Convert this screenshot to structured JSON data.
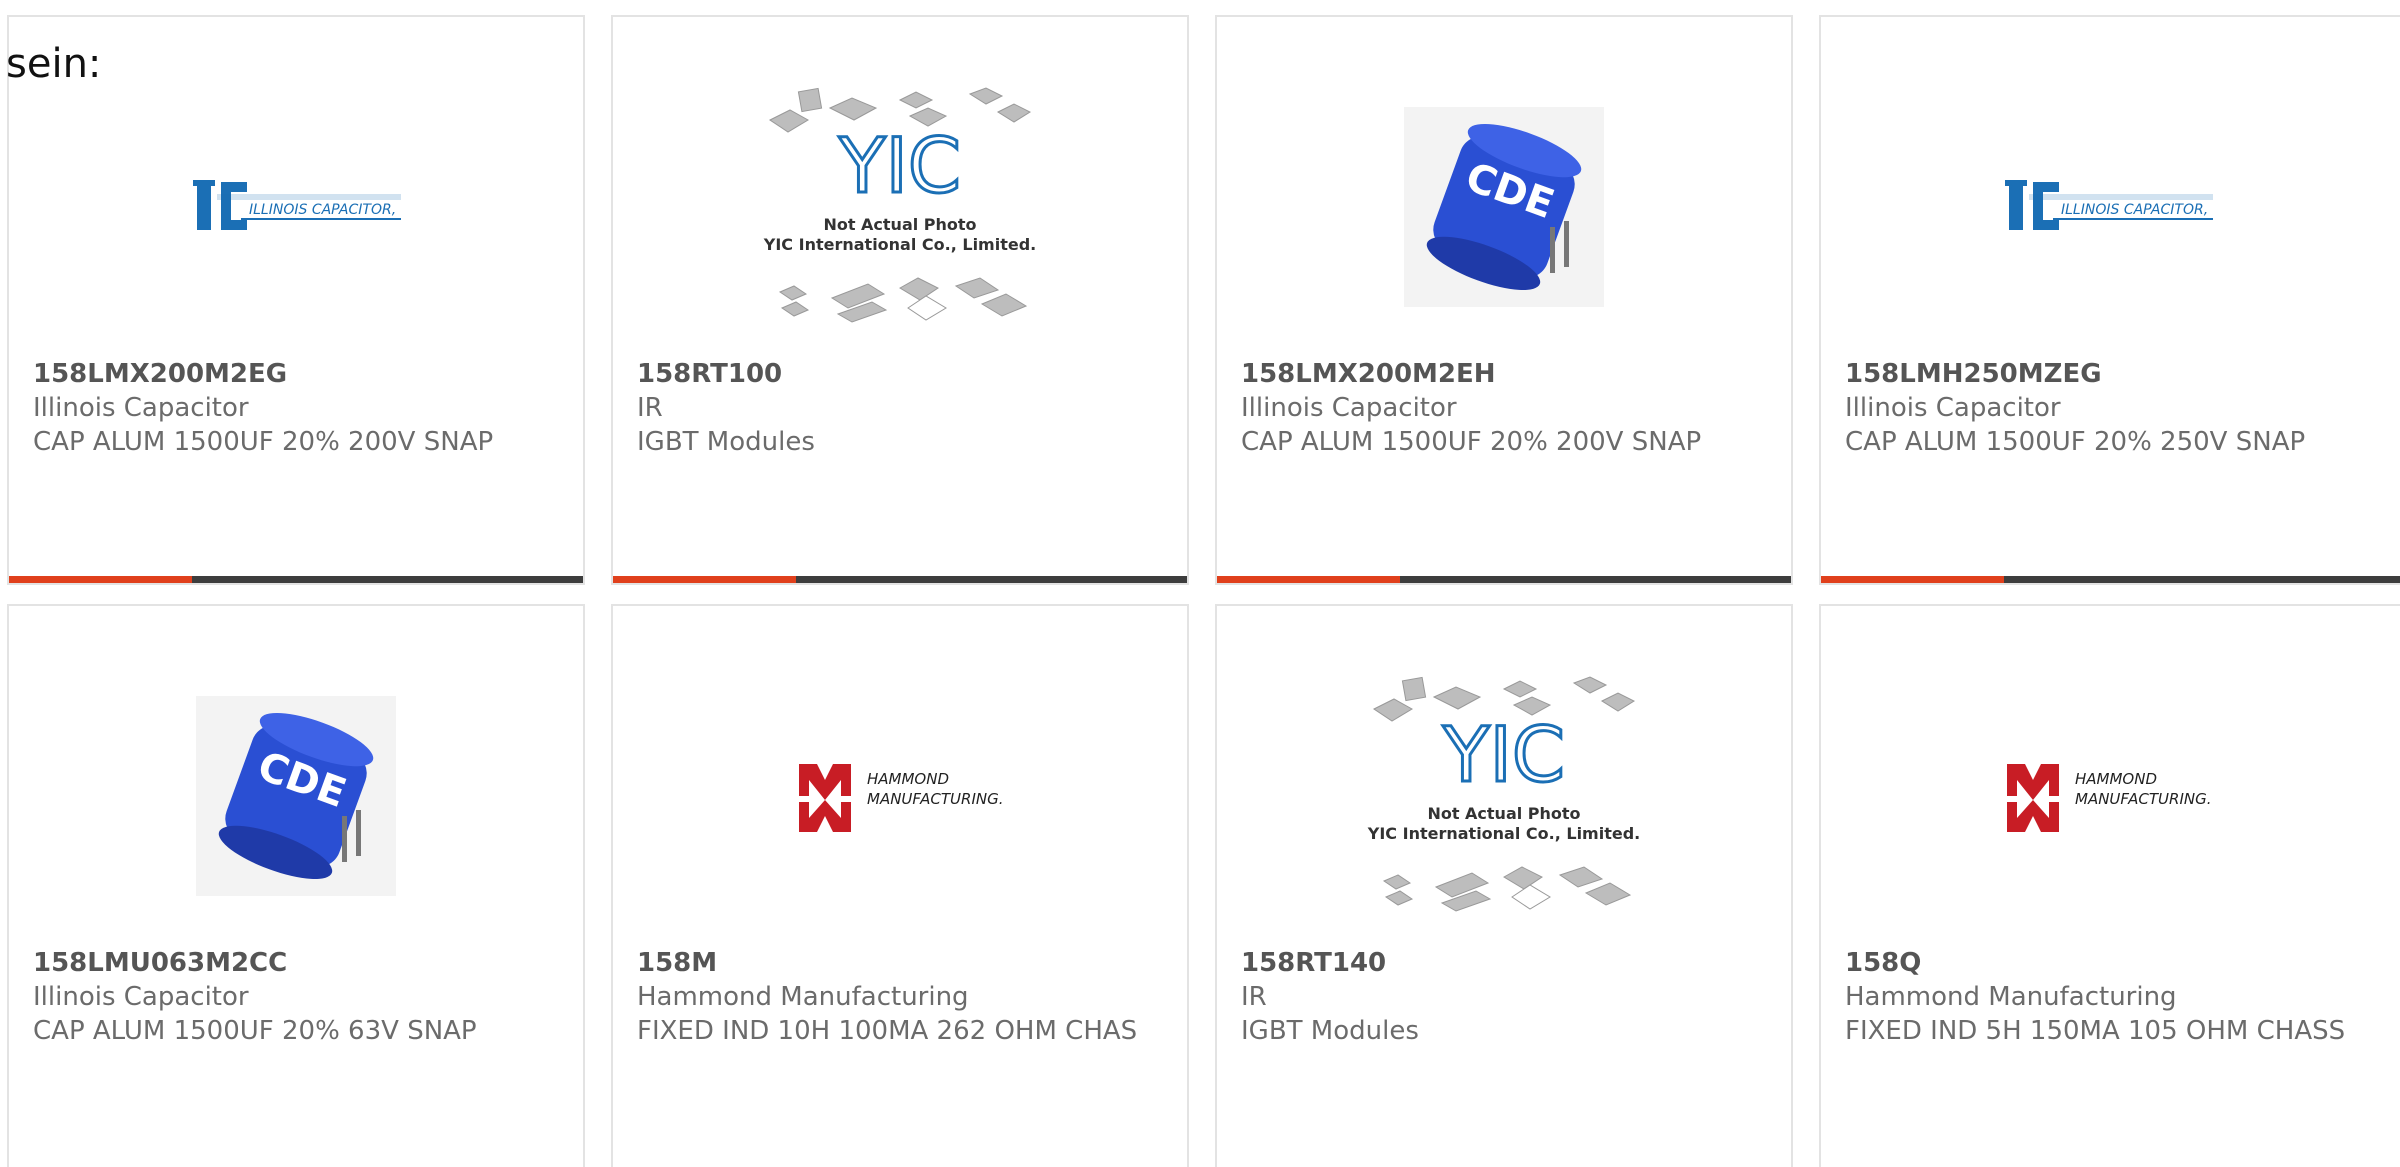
{
  "intro_text": "sein:",
  "products": [
    {
      "part": "158LMX200M2EG",
      "manufacturer": "Illinois Capacitor",
      "description": "CAP ALUM 1500UF 20% 200V SNAP",
      "image": "illinois-capacitor-logo",
      "logo_text": "ILLINOIS CAPACITOR, INC."
    },
    {
      "part": "158RT100",
      "manufacturer": "IR",
      "description": "IGBT Modules",
      "image": "yic-not-actual-photo",
      "logo_text": "YIC",
      "note_line1": "Not Actual Photo",
      "note_line2": "YIC International Co., Limited."
    },
    {
      "part": "158LMX200M2EH",
      "manufacturer": "Illinois Capacitor",
      "description": "CAP ALUM 1500UF 20% 200V SNAP",
      "image": "blue-capacitor-photo",
      "logo_text": "CDE"
    },
    {
      "part": "158LMH250MZEG",
      "manufacturer": "Illinois Capacitor",
      "description": "CAP ALUM 1500UF 20% 250V SNAP",
      "image": "illinois-capacitor-logo",
      "logo_text": "ILLINOIS CAPACITOR, INC."
    },
    {
      "part": "158LMU063M2CC",
      "manufacturer": "Illinois Capacitor",
      "description": "CAP ALUM 1500UF 20% 63V SNAP",
      "image": "blue-capacitor-photo",
      "logo_text": "CDE"
    },
    {
      "part": "158M",
      "manufacturer": "Hammond Manufacturing",
      "description": "FIXED IND 10H 100MA 262 OHM CHAS",
      "image": "hammond-logo",
      "logo_line1": "HAMMOND",
      "logo_line2": "MANUFACTURING."
    },
    {
      "part": "158RT140",
      "manufacturer": "IR",
      "description": "IGBT Modules",
      "image": "yic-not-actual-photo",
      "logo_text": "YIC",
      "note_line1": "Not Actual Photo",
      "note_line2": "YIC International Co., Limited."
    },
    {
      "part": "158Q",
      "manufacturer": "Hammond Manufacturing",
      "description": "FIXED IND 5H 150MA 105 OHM CHASS",
      "image": "hammond-logo",
      "logo_line1": "HAMMOND",
      "logo_line2": "MANUFACTURING."
    }
  ],
  "colors": {
    "accent": "#e0401c",
    "bar": "#3d3d3d",
    "border": "#e3e3e3",
    "text": "#6b6b6b",
    "logo_blue": "#1b6fb5",
    "hammond_red": "#c81d25"
  }
}
